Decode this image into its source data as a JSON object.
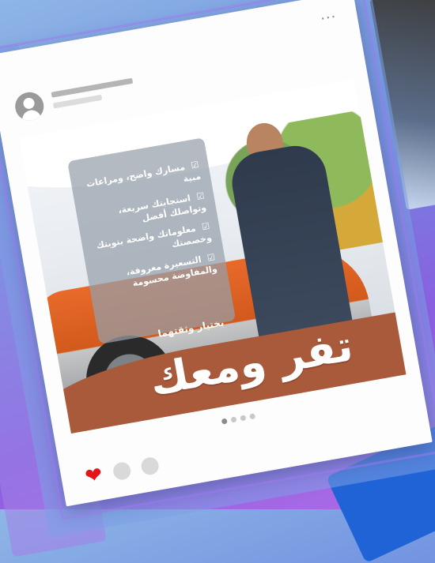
{
  "post": {
    "more_label": "···",
    "overlay_items": [
      "مسارك واضح، ومراعات مبية",
      "استجابتك سريعة، وتواصلك أفضل",
      "معلوماتك واضحة بتوبتك وخصصتك",
      "التسعيرة معروفة، والمفاوضة محسومة"
    ],
    "check_glyph": "☑",
    "tagline": "بختيار وثقتهما",
    "headline": "تفر ومعك",
    "carousel": {
      "total": 4,
      "active_index": 0
    },
    "liked": true
  },
  "colors": {
    "heart": "#e3151a",
    "brand_orange": "#e86a2b",
    "brand_brown": "#a95a3b",
    "background_top": "#8fb6e6",
    "background_bottom": "#b06be6"
  },
  "icons": {
    "avatar": "user-avatar-icon",
    "more": "more-dots-icon",
    "like": "heart-icon",
    "comment": "comment-icon",
    "share": "share-icon"
  }
}
